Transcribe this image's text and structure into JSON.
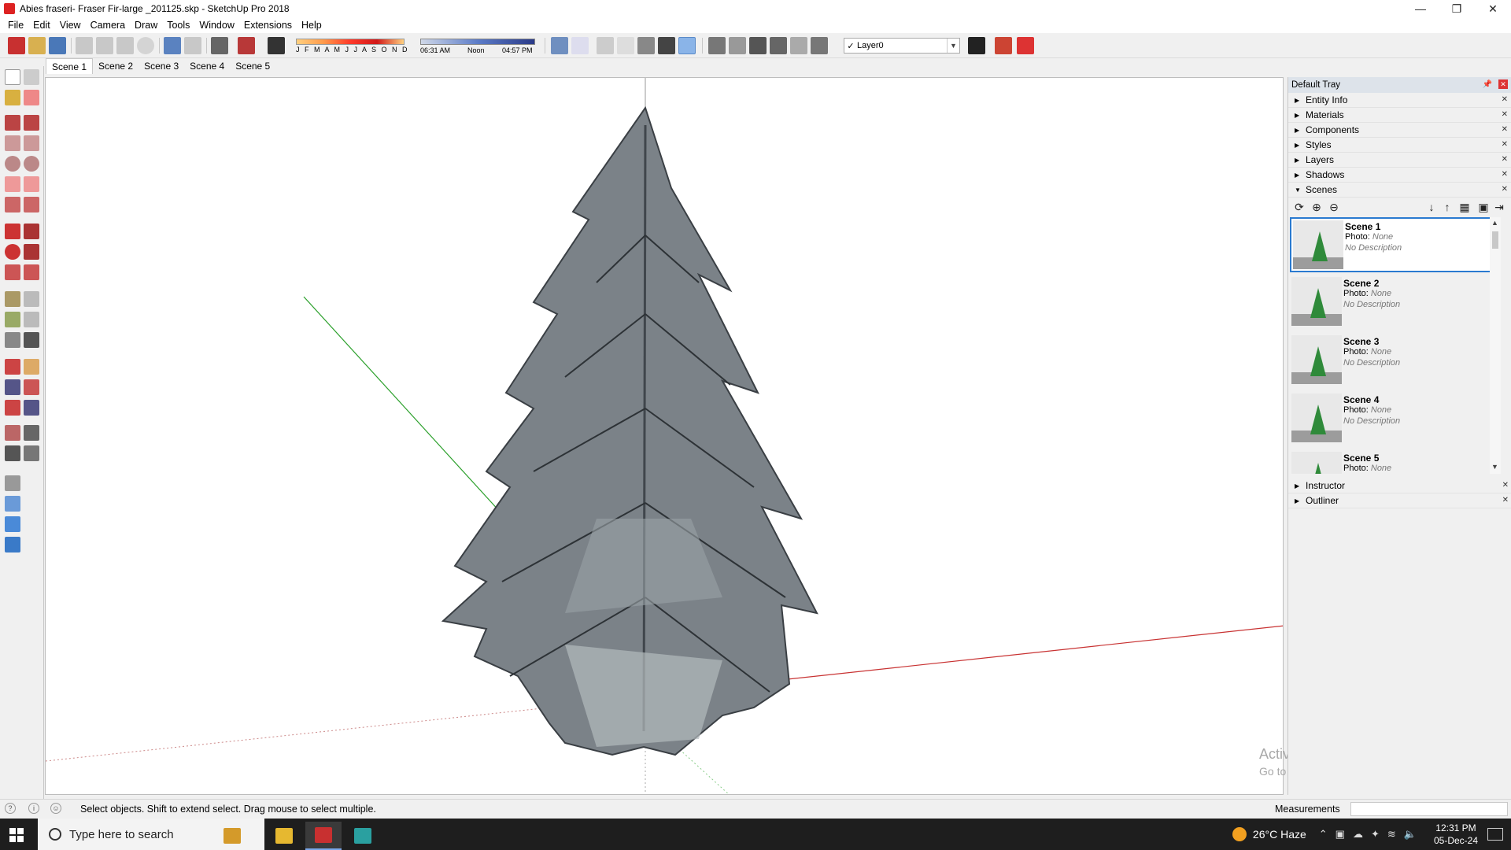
{
  "window": {
    "title": "Abies fraseri- Fraser Fir-large _201125.skp - SketchUp Pro 2018",
    "controls": [
      "—",
      "❐",
      "✕"
    ]
  },
  "menu": [
    "File",
    "Edit",
    "View",
    "Camera",
    "Draw",
    "Tools",
    "Window",
    "Extensions",
    "Help"
  ],
  "toolbar": {
    "months": "J F M A M J J A S O N D",
    "time_start": "06:31 AM",
    "time_mid": "Noon",
    "time_end": "04:57 PM",
    "layer": "Layer0"
  },
  "scene_tabs": [
    "Scene 1",
    "Scene 2",
    "Scene 3",
    "Scene 4",
    "Scene 5"
  ],
  "tray": {
    "title": "Default Tray",
    "panels_top": [
      "Entity Info",
      "Materials",
      "Components",
      "Styles",
      "Layers",
      "Shadows"
    ],
    "scenes_label": "Scenes",
    "scenes": [
      {
        "name": "Scene 1",
        "photo_label": "Photo:",
        "photo": "None",
        "desc": "No Description"
      },
      {
        "name": "Scene 2",
        "photo_label": "Photo:",
        "photo": "None",
        "desc": "No Description"
      },
      {
        "name": "Scene 3",
        "photo_label": "Photo:",
        "photo": "None",
        "desc": "No Description"
      },
      {
        "name": "Scene 4",
        "photo_label": "Photo:",
        "photo": "None",
        "desc": "No Description"
      },
      {
        "name": "Scene 5",
        "photo_label": "Photo:",
        "photo": "None",
        "desc": ""
      }
    ],
    "panels_bottom": [
      "Instructor",
      "Outliner"
    ]
  },
  "status": {
    "message": "Select objects. Shift to extend select. Drag mouse to select multiple.",
    "measurements_label": "Measurements"
  },
  "watermark": {
    "line1": "Activate Windows",
    "line2": "Go to Settings to activate Windows."
  },
  "taskbar": {
    "search_placeholder": "Type here to search",
    "weather": "26°C  Haze",
    "time": "12:31 PM",
    "date": "05-Dec-24"
  },
  "colors": {
    "axis_green": "#2ca02c",
    "axis_red": "#c83232",
    "selection_blue": "#2a7ad0",
    "tree_gray": "#6f767c"
  }
}
